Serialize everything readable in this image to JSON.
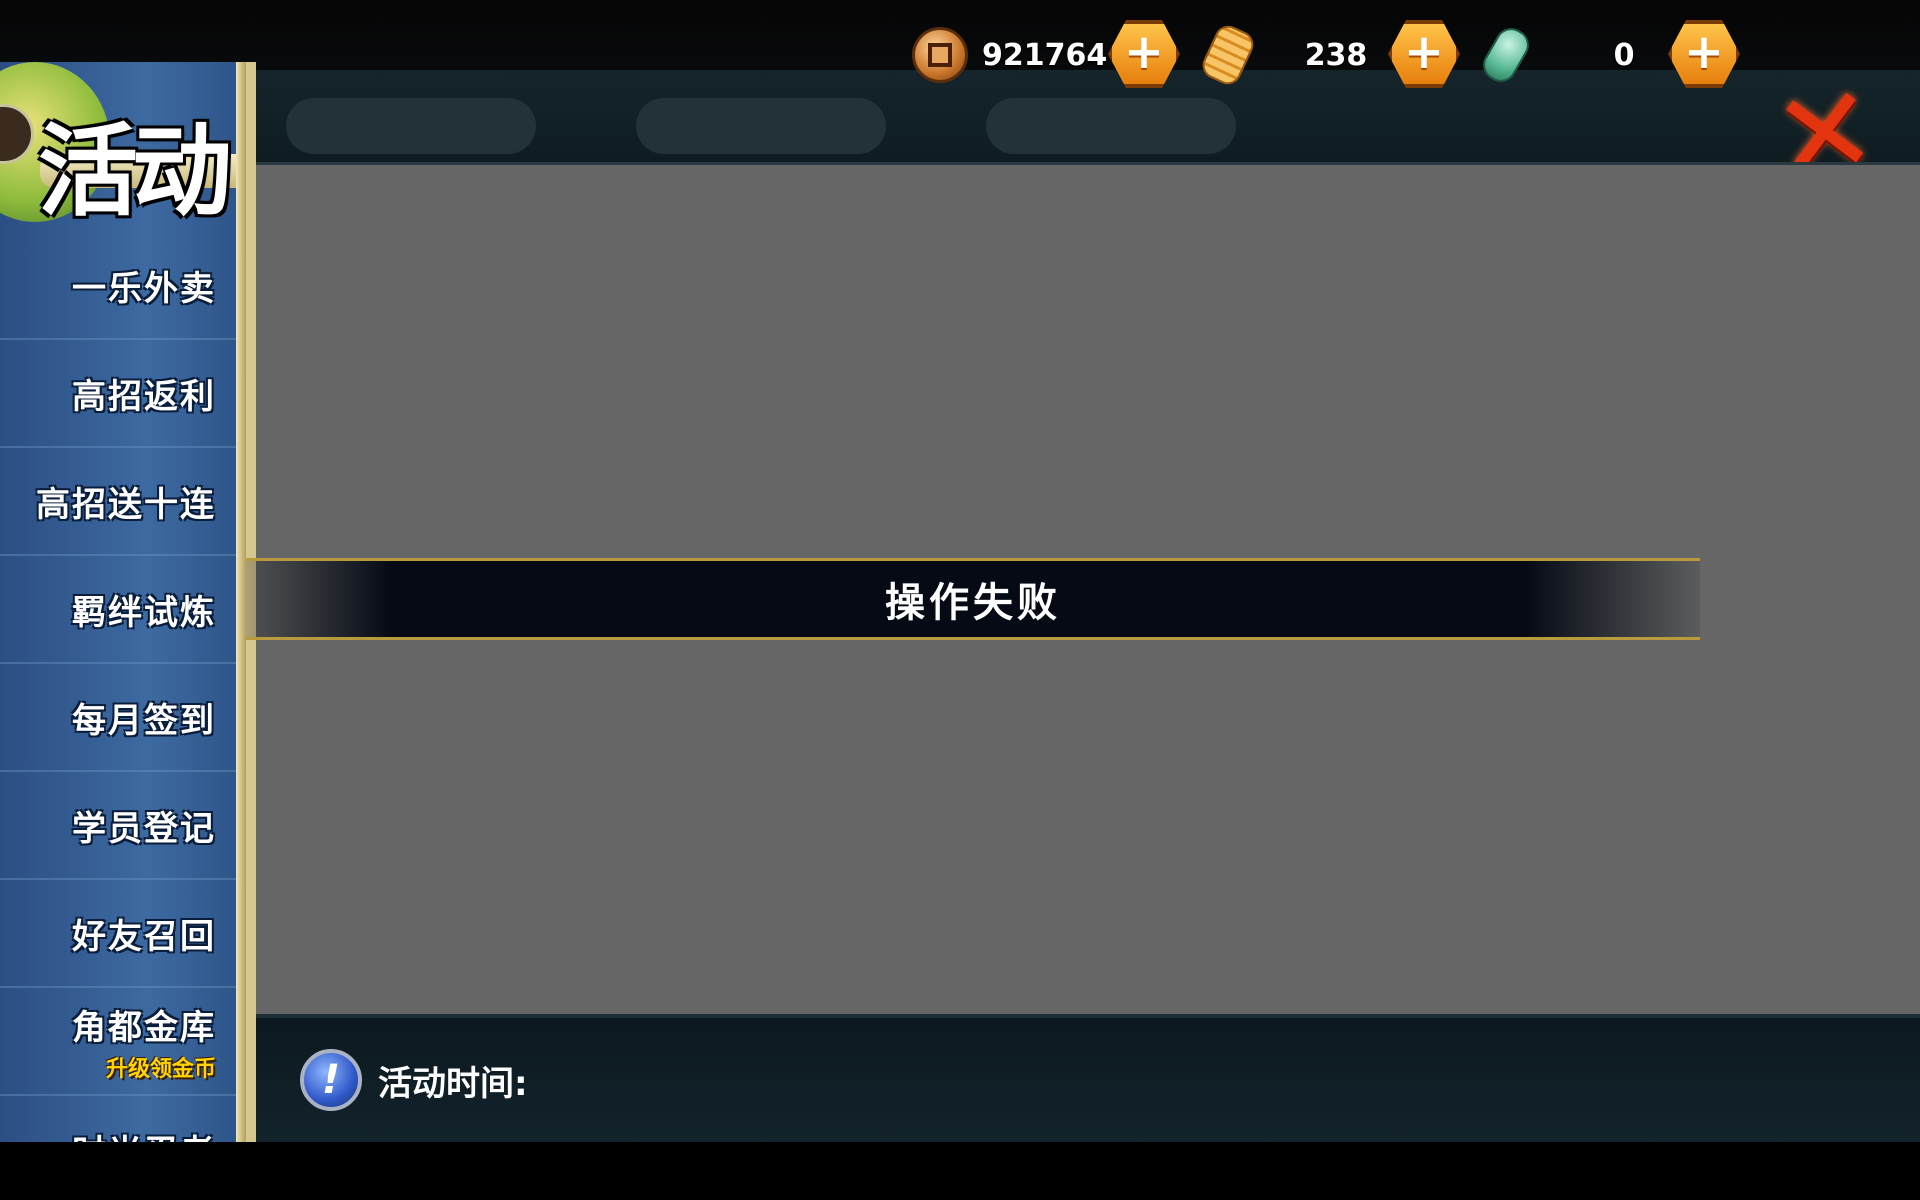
{
  "resources": [
    {
      "name": "coin",
      "icon": "coin-icon",
      "value": "921764"
    },
    {
      "name": "gold",
      "icon": "gold-ingot-icon",
      "value": "238"
    },
    {
      "name": "jade",
      "icon": "jade-icon",
      "value": "0"
    }
  ],
  "add_button_label": "+",
  "close_label": "✕",
  "sidebar": {
    "title": "活动",
    "items": [
      {
        "label": "一乐外卖"
      },
      {
        "label": "高招返利"
      },
      {
        "label": "高招送十连"
      },
      {
        "label": "羁绊试炼"
      },
      {
        "label": "每月签到"
      },
      {
        "label": "学员登记"
      },
      {
        "label": "好友召回"
      },
      {
        "label": "角都金库",
        "sub": "升级领金币"
      },
      {
        "label": "时光忍者"
      }
    ]
  },
  "toast": {
    "message": "操作失败"
  },
  "info": {
    "label": "活动时间:",
    "icon": "info-exclamation-icon"
  },
  "colors": {
    "panel_bg": "#666666",
    "sidebar_bg": "#3d6aa1",
    "accent_orange": "#f39a1e",
    "close_red": "#e33410",
    "sub_label_yellow": "#ffd400"
  }
}
